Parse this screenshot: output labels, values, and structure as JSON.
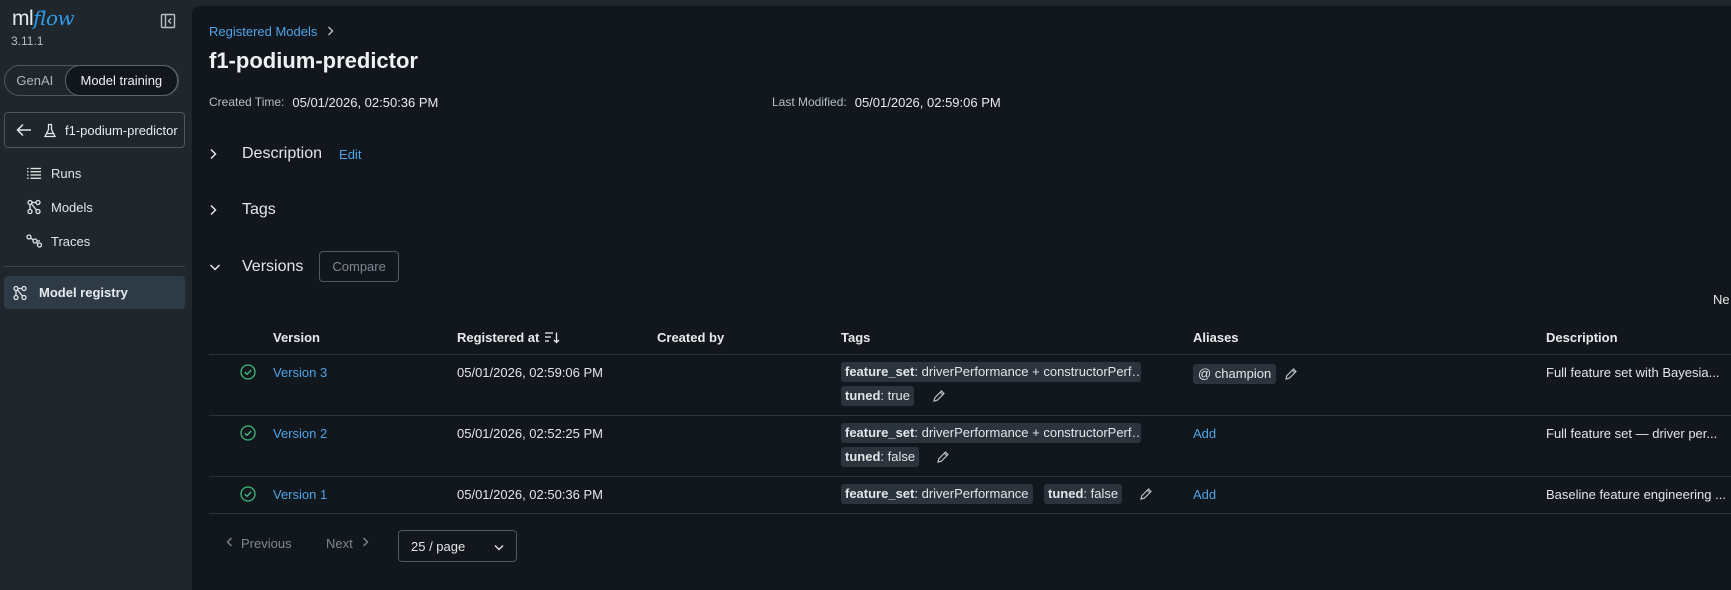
{
  "sidebar": {
    "logo_ml": "ml",
    "logo_flow": "flow",
    "version": "3.11.1",
    "toggle": {
      "genai": "GenAI",
      "model_training": "Model training"
    },
    "experiment_name": "f1-podium-predictor",
    "nav": [
      {
        "label": "Runs",
        "icon": "list-icon"
      },
      {
        "label": "Models",
        "icon": "models-icon"
      },
      {
        "label": "Traces",
        "icon": "traces-icon"
      }
    ],
    "registry_label": "Model registry"
  },
  "main": {
    "breadcrumb": "Registered Models",
    "title": "f1-podium-predictor",
    "created_label": "Created Time:",
    "created_value": "05/01/2026, 02:50:36 PM",
    "modified_label": "Last Modified:",
    "modified_value": "05/01/2026, 02:59:06 PM",
    "description_title": "Description",
    "edit_label": "Edit",
    "tags_title": "Tags",
    "versions_title": "Versions",
    "compare_label": "Compare",
    "truncated_right_text": "Ne"
  },
  "table": {
    "headers": {
      "version": "Version",
      "registered_at": "Registered at",
      "created_by": "Created by",
      "tags": "Tags",
      "aliases": "Aliases",
      "description": "Description"
    },
    "rows": [
      {
        "version": "Version 3",
        "registered_at": "05/01/2026, 02:59:06 PM",
        "tag1_key": "feature_set",
        "tag1_val": ": driverPerformance + constructorPerf…",
        "tag2_key": "tuned",
        "tag2_val": ": true",
        "alias": "@ champion",
        "description": "Full feature set with Bayesia..."
      },
      {
        "version": "Version 2",
        "registered_at": "05/01/2026, 02:52:25 PM",
        "tag1_key": "feature_set",
        "tag1_val": ": driverPerformance + constructorPerf…",
        "tag2_key": "tuned",
        "tag2_val": ": false",
        "alias_add": "Add",
        "description": "Full feature set — driver per..."
      },
      {
        "version": "Version 1",
        "registered_at": "05/01/2026, 02:50:36 PM",
        "tag1_key": "feature_set",
        "tag1_val": ": driverPerformance",
        "tag2_key": "tuned",
        "tag2_val": ": false",
        "alias_add": "Add",
        "description": "Baseline feature engineering ..."
      }
    ]
  },
  "pagination": {
    "previous": "Previous",
    "next": "Next",
    "page_size": "25 / page"
  },
  "colors": {
    "accent": "#4ea3e8",
    "success": "#3fb97a",
    "sidebar_bg": "#1f272d",
    "main_bg": "#11171c"
  }
}
